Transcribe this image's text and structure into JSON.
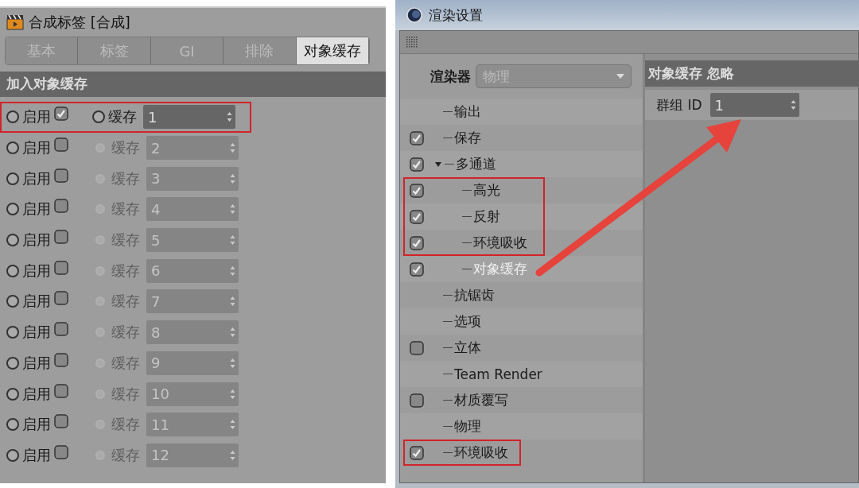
{
  "tag_panel": {
    "title": "合成标签 [合成]",
    "tabs": [
      {
        "label": "基本",
        "selected": false
      },
      {
        "label": "标签",
        "selected": false
      },
      {
        "label": "GI",
        "selected": false
      },
      {
        "label": "排除",
        "selected": false
      },
      {
        "label": "对象缓存",
        "selected": true
      }
    ],
    "section": "加入对象缓存",
    "rows": [
      {
        "enable_label": "启用",
        "enabled": true,
        "cache_label": "缓存",
        "value": "1",
        "active": true,
        "annotated": true
      },
      {
        "enable_label": "启用",
        "enabled": false,
        "cache_label": "缓存",
        "value": "2",
        "active": false,
        "annotated": false
      },
      {
        "enable_label": "启用",
        "enabled": false,
        "cache_label": "缓存",
        "value": "3",
        "active": false,
        "annotated": false
      },
      {
        "enable_label": "启用",
        "enabled": false,
        "cache_label": "缓存",
        "value": "4",
        "active": false,
        "annotated": false
      },
      {
        "enable_label": "启用",
        "enabled": false,
        "cache_label": "缓存",
        "value": "5",
        "active": false,
        "annotated": false
      },
      {
        "enable_label": "启用",
        "enabled": false,
        "cache_label": "缓存",
        "value": "6",
        "active": false,
        "annotated": false
      },
      {
        "enable_label": "启用",
        "enabled": false,
        "cache_label": "缓存",
        "value": "7",
        "active": false,
        "annotated": false
      },
      {
        "enable_label": "启用",
        "enabled": false,
        "cache_label": "缓存",
        "value": "8",
        "active": false,
        "annotated": false
      },
      {
        "enable_label": "启用",
        "enabled": false,
        "cache_label": "缓存",
        "value": "9",
        "active": false,
        "annotated": false
      },
      {
        "enable_label": "启用",
        "enabled": false,
        "cache_label": "缓存",
        "value": "10",
        "active": false,
        "annotated": false
      },
      {
        "enable_label": "启用",
        "enabled": false,
        "cache_label": "缓存",
        "value": "11",
        "active": false,
        "annotated": false
      },
      {
        "enable_label": "启用",
        "enabled": false,
        "cache_label": "缓存",
        "value": "12",
        "active": false,
        "annotated": false
      }
    ]
  },
  "render_window": {
    "title": "渲染设置",
    "renderer_label": "渲染器",
    "renderer_value": "物理",
    "tree": [
      {
        "label": "输出",
        "kind": "plain",
        "selected": false,
        "annotated": false
      },
      {
        "label": "保存",
        "kind": "check",
        "checked": true,
        "selected": false,
        "annotated": false
      },
      {
        "label": "多通道",
        "kind": "check",
        "checked": true,
        "selected": false,
        "annotated": false,
        "expanded": true,
        "children": [
          {
            "label": "高光",
            "kind": "check",
            "checked": true,
            "selected": false,
            "annotated": true
          },
          {
            "label": "反射",
            "kind": "check",
            "checked": true,
            "selected": false,
            "annotated": true
          },
          {
            "label": "环境吸收",
            "kind": "check",
            "checked": true,
            "selected": false,
            "annotated": true
          },
          {
            "label": "对象缓存",
            "kind": "check",
            "checked": true,
            "selected": true,
            "annotated": false
          }
        ]
      },
      {
        "label": "抗锯齿",
        "kind": "plain",
        "selected": false,
        "annotated": false
      },
      {
        "label": "选项",
        "kind": "plain",
        "selected": false,
        "annotated": false
      },
      {
        "label": "立体",
        "kind": "check",
        "checked": false,
        "selected": false,
        "annotated": false
      },
      {
        "label": "Team Render",
        "kind": "plain",
        "selected": false,
        "annotated": false
      },
      {
        "label": "材质覆写",
        "kind": "check",
        "checked": false,
        "selected": false,
        "annotated": false
      },
      {
        "label": "物理",
        "kind": "plain",
        "selected": false,
        "annotated": false
      },
      {
        "label": "环境吸收",
        "kind": "check",
        "checked": true,
        "selected": false,
        "annotated": true
      }
    ],
    "group_title": "对象缓存 忽略",
    "field_label": "群组 ID",
    "field_value": "1"
  }
}
